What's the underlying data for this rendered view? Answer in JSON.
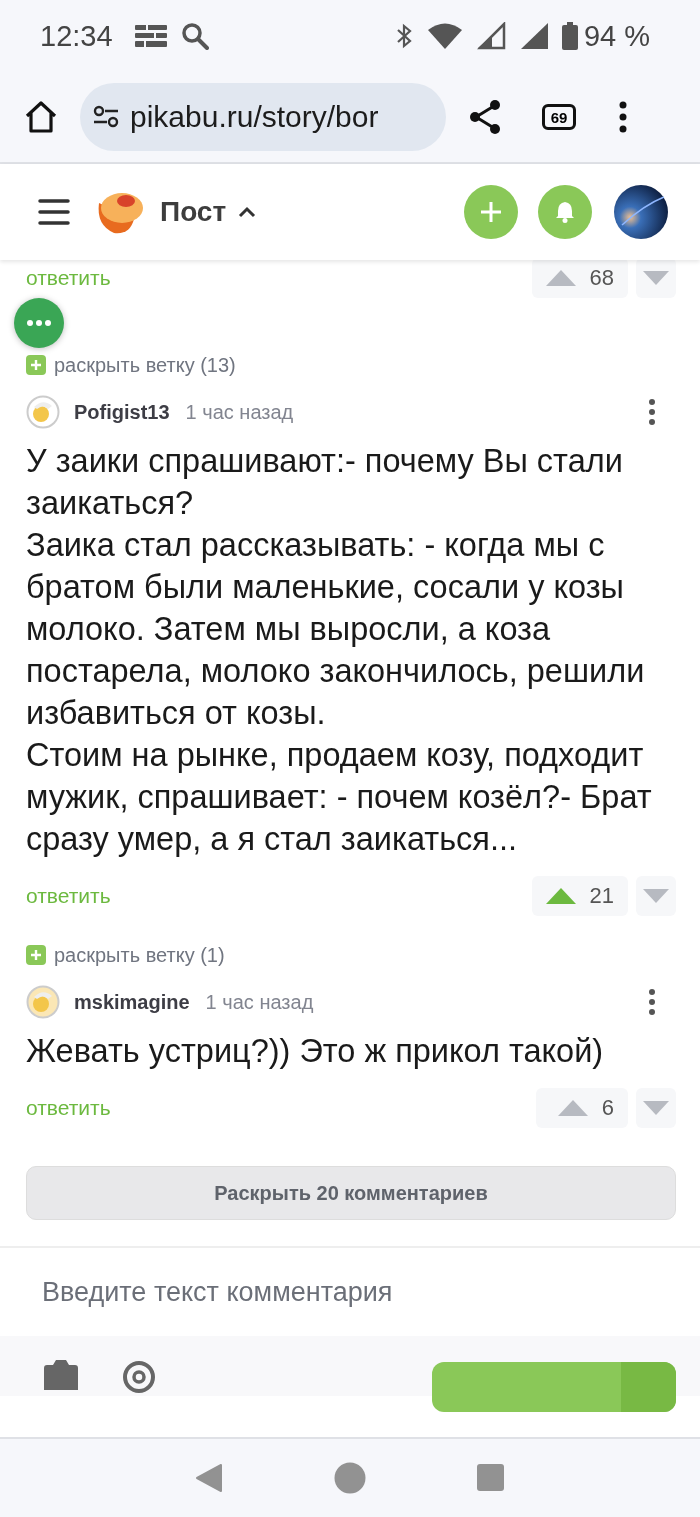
{
  "status_bar": {
    "time": "12:34",
    "battery": "94 %"
  },
  "browser": {
    "url": "pikabu.ru/story/bor",
    "tab_count": "69"
  },
  "site_header": {
    "title": "Пост"
  },
  "partial_comment": {
    "reply": "ответить",
    "votes": "68",
    "upvoted": false
  },
  "comments": [
    {
      "expand": "раскрыть ветку (13)",
      "author": "Pofigist13",
      "time": "1 час назад",
      "paragraphs": [
        "У заики спрашивают:- почему Вы стали заикаться?",
        "Заика стал рассказывать: - когда мы с братом были маленькие, сосали у козы молоко. Затем мы выросли, а коза постарела, молоко закончилось, решили избавиться от козы.",
        "Стоим на рынке, продаем козу, подходит мужик, спрашивает: - почем козёл?- Брат сразу умер, а я стал заикаться..."
      ],
      "reply": "ответить",
      "votes": "21",
      "upvoted": true
    },
    {
      "expand": "раскрыть ветку (1)",
      "author": "mskimagine",
      "time": "1 час назад",
      "paragraphs": [
        "Жевать устриц?)) Это ж прикол такой)"
      ],
      "reply": "ответить",
      "votes": "6",
      "upvoted": false
    }
  ],
  "expand_all": "Раскрыть 20 комментариев",
  "comment_input": {
    "placeholder": "Введите текст комментария"
  }
}
